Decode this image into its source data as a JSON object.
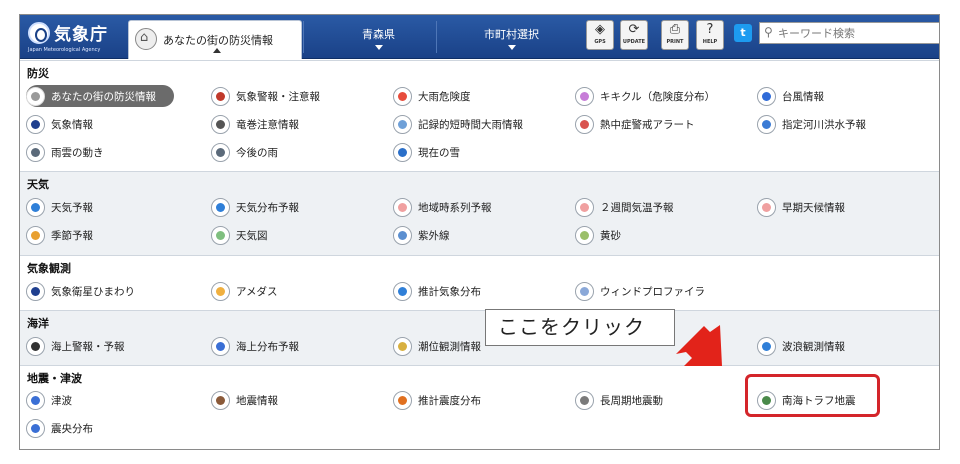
{
  "header": {
    "logo_name": "気象庁",
    "logo_sub": "Japan Meteorological Agency",
    "home_tab": "あなたの街の防災情報",
    "home_icon_text": "HOME",
    "tab_prefecture": "青森県",
    "tab_municipality": "市町村選択",
    "tools": [
      {
        "glyph": "◈",
        "label": "GPS",
        "icon": "gps-icon"
      },
      {
        "glyph": "⟳",
        "label": "UPDATE",
        "icon": "update-icon"
      },
      {
        "glyph": "⎙",
        "label": "PRINT",
        "icon": "print-icon"
      },
      {
        "glyph": "?",
        "label": "HELP",
        "icon": "help-icon"
      }
    ],
    "twitter_glyph": "t",
    "search_glyph": "⚲",
    "search_placeholder": "キーワード検索"
  },
  "sections": [
    {
      "title": "防災",
      "items": [
        "あなたの街の防災情報",
        "気象警報・注意報",
        "大雨危険度",
        "キキクル（危険度分布）",
        "台風情報",
        "気象情報",
        "竜巻注意情報",
        "記録的短時間大雨情報",
        "熱中症警戒アラート",
        "指定河川洪水予報",
        "雨雲の動き",
        "今後の雨",
        "現在の雪"
      ]
    },
    {
      "title": "天気",
      "items": [
        "天気予報",
        "天気分布予報",
        "地域時系列予報",
        "２週間気温予報",
        "早期天候情報",
        "季節予報",
        "天気図",
        "紫外線",
        "黄砂"
      ]
    },
    {
      "title": "気象観測",
      "items": [
        "気象衛星ひまわり",
        "アメダス",
        "推計気象分布",
        "ウィンドプロファイラ"
      ]
    },
    {
      "title": "海洋",
      "items": [
        "海上警報・予報",
        "海上分布予報",
        "潮位観測情報",
        "",
        "波浪観測情報"
      ]
    },
    {
      "title": "地震・津波",
      "items": [
        "津波",
        "地震情報",
        "推計震度分布",
        "長周期地震動",
        "南海トラフ地震",
        "震央分布"
      ]
    }
  ],
  "annotation": "ここをクリック",
  "colors": {
    "header": "#1a4187",
    "selected_item": "#6b6b6b",
    "highlight": "#d4252a",
    "arrow": "#e2231a"
  }
}
